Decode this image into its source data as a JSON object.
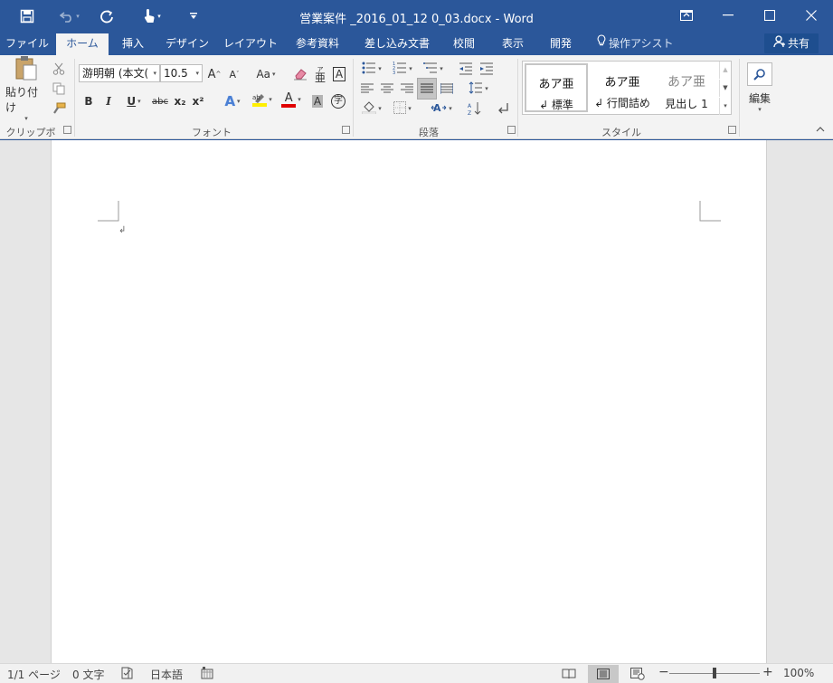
{
  "titlebar": {
    "title": "営業案件 _2016_01_12 0_03.docx - Word",
    "save_icon": "save-icon",
    "undo_icon": "undo-icon",
    "redo_icon": "redo-icon",
    "touch_icon": "touch-mode-icon",
    "customize_icon": "customize-qat-icon",
    "ribbon_display_icon": "ribbon-display-options-icon"
  },
  "tabs": [
    {
      "label": "ファイル"
    },
    {
      "label": "ホーム"
    },
    {
      "label": "挿入"
    },
    {
      "label": "デザイン"
    },
    {
      "label": "レイアウト"
    },
    {
      "label": "参考資料"
    },
    {
      "label": "差し込み文書"
    },
    {
      "label": "校閲"
    },
    {
      "label": "表示"
    },
    {
      "label": "開発"
    }
  ],
  "tell_me": "操作アシスト",
  "share": "共有",
  "ribbon": {
    "clipboard": {
      "paste_label": "貼り付け",
      "group_label": "クリップボード"
    },
    "font": {
      "font_name": "游明朝 (本文(",
      "font_size": "10.5",
      "change_case": "Aa",
      "group_label": "フォント",
      "bold": "B",
      "italic": "I",
      "underline": "U",
      "strike": "abc",
      "subscript": "x₂",
      "superscript": "x²",
      "grow": "A",
      "shrink": "A",
      "text_effects": "A",
      "font_color": "A",
      "char_shading": "A",
      "enclosed": "字",
      "char_border": "A",
      "phonetic": "亜"
    },
    "paragraph": {
      "group_label": "段落"
    },
    "styles": {
      "group_label": "スタイル",
      "items": [
        {
          "sample": "あア亜",
          "name": "↲ 標準"
        },
        {
          "sample": "あア亜",
          "name": "↲ 行間詰め"
        },
        {
          "sample": "あア亜",
          "name": "見出し 1"
        }
      ]
    },
    "editing": {
      "label": "編集"
    }
  },
  "document": {
    "paragraph_mark": "↲"
  },
  "statusbar": {
    "page": "1/1 ページ",
    "words": "0 文字",
    "language": "日本語",
    "zoom": "100%",
    "zoom_out": "−",
    "zoom_in": "+"
  }
}
